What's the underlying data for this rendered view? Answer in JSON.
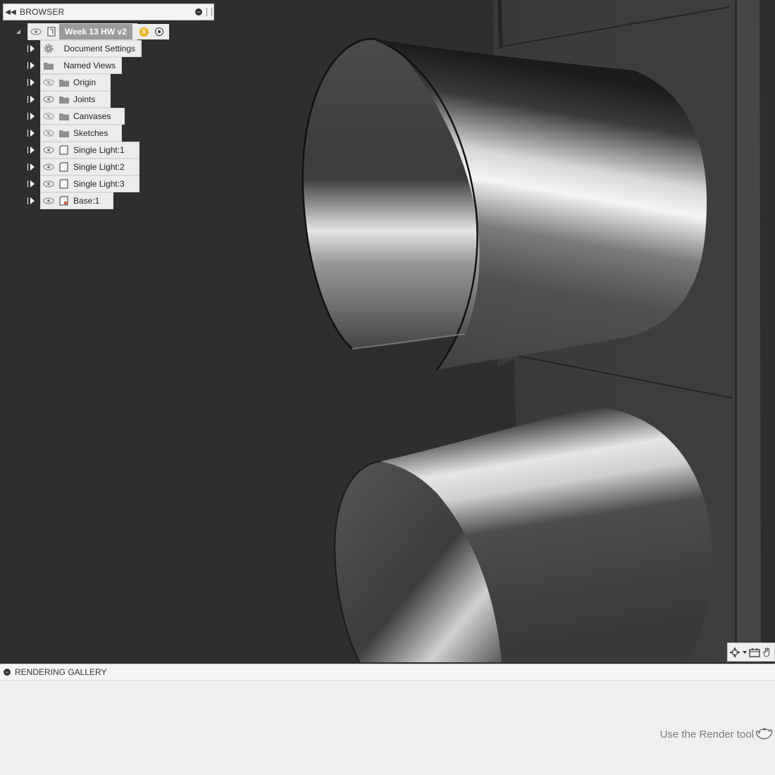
{
  "browser": {
    "title": "BROWSER",
    "root": {
      "label": "Week 13 HW v2",
      "badge": "S"
    },
    "items": [
      {
        "label": "Document Settings",
        "icon": "gear-icon",
        "eye": "none"
      },
      {
        "label": "Named Views",
        "icon": "folder-icon",
        "eye": "none"
      },
      {
        "label": "Origin",
        "icon": "folder-icon",
        "eye": "hidden"
      },
      {
        "label": "Joints",
        "icon": "folder-icon",
        "eye": "visible"
      },
      {
        "label": "Canvases",
        "icon": "folder-icon",
        "eye": "hidden"
      },
      {
        "label": "Sketches",
        "icon": "folder-icon",
        "eye": "hidden"
      },
      {
        "label": "Single Light:1",
        "icon": "component-icon",
        "eye": "visible"
      },
      {
        "label": "Single Light:2",
        "icon": "component-icon",
        "eye": "visible"
      },
      {
        "label": "Single Light:3",
        "icon": "component-icon",
        "eye": "visible"
      },
      {
        "label": "Base:1",
        "icon": "component-linked-icon",
        "eye": "visible"
      }
    ]
  },
  "gallery": {
    "title": "RENDERING GALLERY",
    "hint": "Use the Render tool"
  },
  "colors": {
    "viewport_bg": "#2e2e2e",
    "panel_bg": "#ececec",
    "badge": "#f1b414"
  }
}
